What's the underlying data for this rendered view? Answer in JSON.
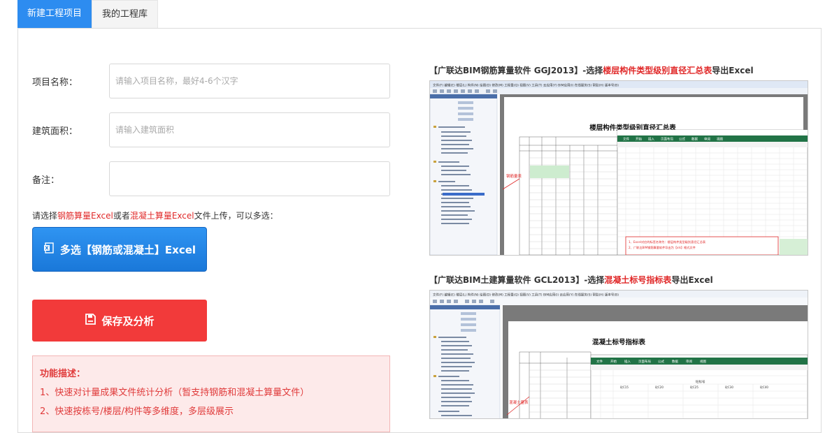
{
  "tabs": [
    {
      "label": "新建工程项目"
    },
    {
      "label": "我的工程库"
    }
  ],
  "form": {
    "project_name_label": "项目名称：",
    "project_name_placeholder": "请输入项目名称，最好4-6个汉字",
    "area_label": "建筑面积：",
    "area_placeholder": "请输入建筑面积",
    "note_label": "备注："
  },
  "upload_hint": {
    "pre": "请选择",
    "red1": "钢筋算量Excel",
    "mid": "或者",
    "red2": "混凝土算量Excel",
    "post": "文件上传，可以多选："
  },
  "buttons": {
    "multi_select": "多选【钢筋或混凝土】Excel",
    "save_analyze": "保存及分析"
  },
  "func_desc": {
    "title": "功能描述：",
    "items": [
      "1、快速对计量成果文件统计分析（暂支持钢筋和混凝土算量文件）",
      "2、快速按栋号/楼层/构件等多维度，多层级展示"
    ]
  },
  "examples": [
    {
      "caption_pre": "【广联达BIM钢筋算量软件 GGJ2013】-选择",
      "caption_red": "楼层构件类型级别直径汇总表",
      "caption_post": "导出Excel",
      "screenshot": {
        "menu": "文件(F)  编辑(E)  楼层(L)  构件(N)  绘图(D)  修改(M)  工程量(Q)  视图(V)  工具(T)  云应用(Y)  BIM应用(I)  在线服务(S)  帮助(H)  版本号(B)",
        "title": "楼层构件类型级别直径汇总表",
        "annotation": "钢筋量表",
        "excel_tabs": [
          "文件",
          "开始",
          "插入",
          "页面布局",
          "公式",
          "数据",
          "审阅",
          "视图"
        ],
        "note_lines": [
          "1、Excel对应的标签名称为：楼层构件类型级别直径汇总表",
          "2、广联达BIM钢筋算量软件导出为【xls】格式文件"
        ]
      }
    },
    {
      "caption_pre": "【广联达BIM土建算量软件 GCL2013】-选择",
      "caption_red": "混凝土标号指标表",
      "caption_post": "导出Excel",
      "screenshot": {
        "menu": "文件(F)  编辑(E)  楼层(L)  构件(N)  绘图(D)  修改(M)  工程量(Q)  视图(V)  工具(T)  BIM应用(I)  云应用(Y)  在线服务(S)  帮助(H)  版本号(B)",
        "title": "混凝土标号指标表",
        "annotation": "混凝土量表",
        "excel_tabs": [
          "文件",
          "开始",
          "插入",
          "页面布局",
          "公式",
          "数据",
          "审阅",
          "视图"
        ],
        "col_header": "砼标号",
        "col_items": [
          "砼C15",
          "砼C20",
          "砼C25",
          "砼C30",
          "砼C40"
        ]
      }
    }
  ],
  "colors": {
    "primary": "#2d8cf0",
    "danger": "#f23a3a",
    "highlight_red": "#e02828",
    "excel_green": "#217346"
  }
}
